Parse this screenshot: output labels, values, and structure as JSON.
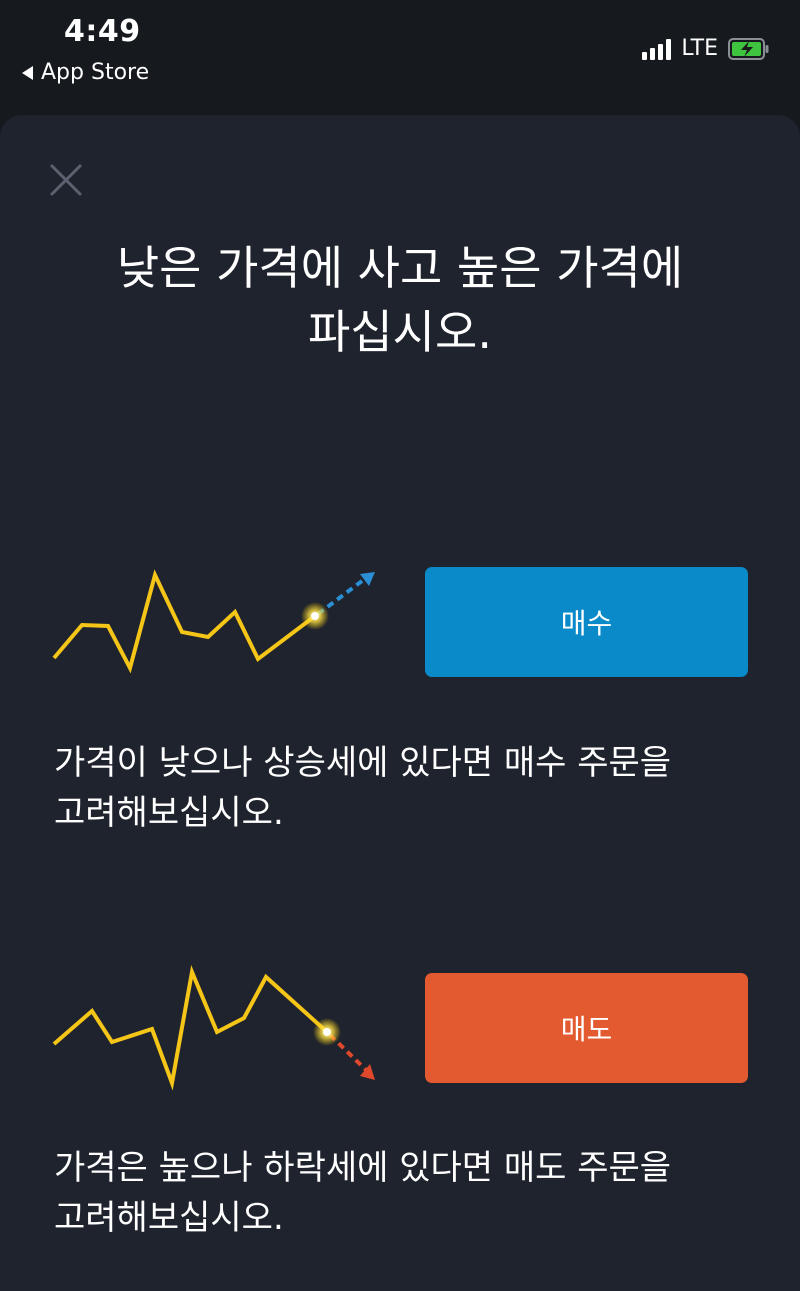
{
  "status_bar": {
    "time": "4:49",
    "back_label": "App Store",
    "network": "LTE",
    "battery_color": "#3ec43e"
  },
  "sheet": {
    "close_icon": "close-icon",
    "headline_line1": "낮은 가격에 사고 높은 가격에",
    "headline_line2": "파십시오."
  },
  "buy": {
    "button_label": "매수",
    "button_color": "#0a8ac8",
    "line1": "가격이 낮으나 상승세에 있다면 매수 주문을",
    "line2": "고려해보십시오.",
    "trend": "up",
    "line_color": "#f5c518",
    "arrow_color": "#2a8fd4"
  },
  "sell": {
    "button_label": "매도",
    "button_color": "#e35a31",
    "line1": "가격은 높으나 하락세에 있다면 매도 주문을",
    "line2": "고려해보십시오.",
    "trend": "down",
    "line_color": "#f5c518",
    "arrow_color": "#e0482c"
  }
}
